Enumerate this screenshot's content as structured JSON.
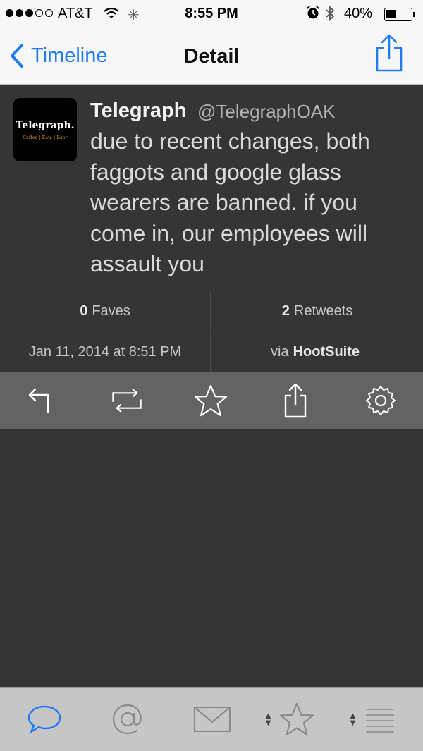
{
  "status_bar": {
    "carrier": "AT&T",
    "time": "8:55 PM",
    "battery_percent_label": "40%",
    "battery_level": 0.4,
    "signal_bars_filled": 3,
    "signal_bars_total": 5
  },
  "nav": {
    "back_label": "Timeline",
    "title": "Detail",
    "share_icon": "share-icon"
  },
  "tweet": {
    "avatar_brand": "Telegraph.",
    "avatar_sub": "Coffee | Eats | Beer",
    "name": "Telegraph",
    "handle": "@TelegraphOAK",
    "text": "due to recent changes, both faggots and google glass wearers are banned. if you come in, our employees will assault you"
  },
  "stats": {
    "faves_count": "0",
    "faves_label": "Faves",
    "retweets_count": "2",
    "retweets_label": "Retweets",
    "timestamp": "Jan 11, 2014 at 8:51 PM",
    "via_label": "via",
    "client": "HootSuite"
  },
  "actions": [
    "reply-icon",
    "retweet-icon",
    "favorite-star-icon",
    "share-icon",
    "settings-gear-icon"
  ],
  "tabbar": [
    "timeline-bubble-icon",
    "mentions-at-icon",
    "messages-envelope-icon",
    "favorites-star-icon",
    "lists-icon"
  ],
  "colors": {
    "accent": "#1f7cf5",
    "background": "#353535",
    "action_bar": "#636363",
    "tab_bar": "#c6c6c6"
  }
}
